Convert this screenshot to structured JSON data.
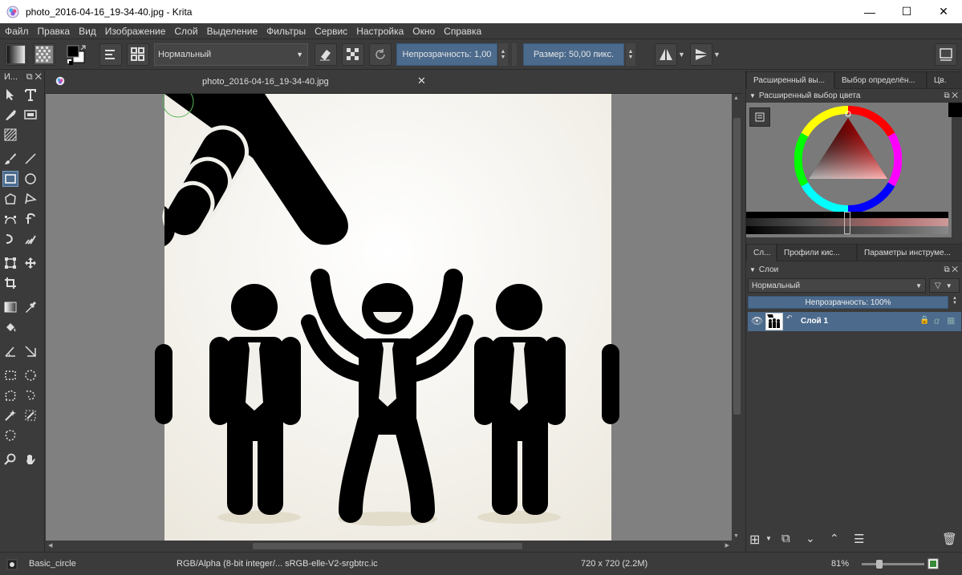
{
  "window": {
    "title": "photo_2016-04-16_19-34-40.jpg - Krita",
    "minimize_glyph": "—",
    "maximize_glyph": "☐",
    "close_glyph": "✕"
  },
  "menu": [
    "Файл",
    "Правка",
    "Вид",
    "Изображение",
    "Слой",
    "Выделение",
    "Фильтры",
    "Сервис",
    "Настройка",
    "Окно",
    "Справка"
  ],
  "toolbar": {
    "blend_mode": "Нормальный",
    "opacity_label": "Непрозрачность:  1,00",
    "size_label": "Размер:  50,00 пикс."
  },
  "toolbox": {
    "title": "И..."
  },
  "document": {
    "tab_name": "photo_2016-04-16_19-34-40.jpg"
  },
  "dock": {
    "top_tabs": [
      "Расширенный вы...",
      "Выбор определён...",
      "Цв."
    ],
    "color_panel_title": "Расширенный выбор цвета",
    "mid_tabs": [
      "Сл...",
      "Профили кис...",
      "Параметры инструме..."
    ],
    "layers_panel_title": "Слои",
    "layers_blend_mode": "Нормальный",
    "layers_opacity": "Непрозрачность:  100%",
    "layers": [
      {
        "name": "Слой 1"
      }
    ]
  },
  "status": {
    "brush": "Basic_circle",
    "color_space": "RGB/Alpha (8-bit integer/...  sRGB-elle-V2-srgbtrc.ic",
    "dimensions": "720 x 720 (2.2M)",
    "zoom": "81%"
  },
  "colors": {
    "accent": "#4b6a8c",
    "panel": "#3b3b3b",
    "canvas_bg": "#808080",
    "image_bg": "#f2f0ea"
  }
}
